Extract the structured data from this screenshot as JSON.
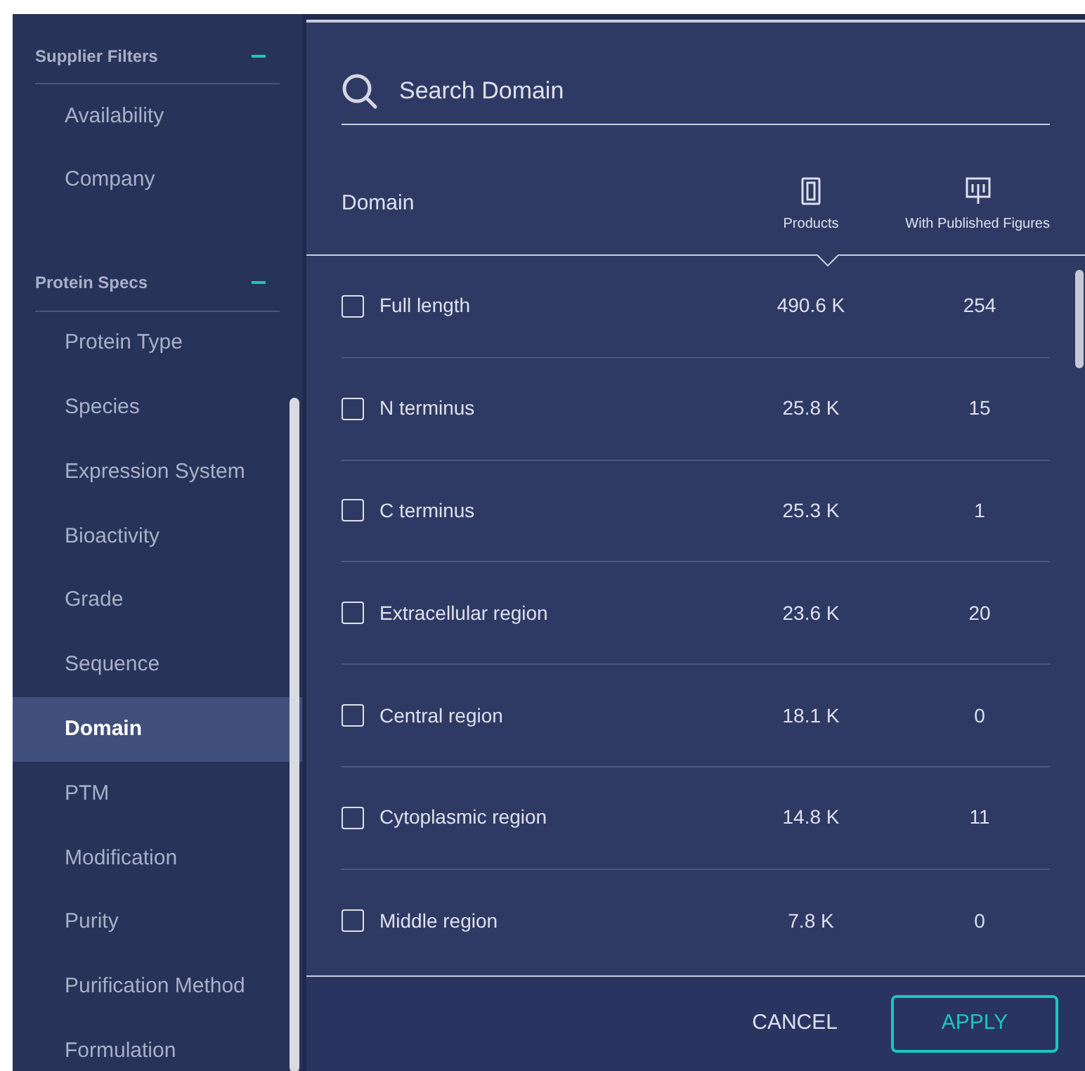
{
  "sidebar": {
    "groups": [
      {
        "title": "Supplier Filters",
        "expanded": true,
        "items": [
          {
            "label": "Availability",
            "selected": false
          },
          {
            "label": "Company",
            "selected": false
          }
        ]
      },
      {
        "title": "Protein Specs",
        "expanded": true,
        "items": [
          {
            "label": "Protein Type",
            "selected": false
          },
          {
            "label": "Species",
            "selected": false
          },
          {
            "label": "Expression System",
            "selected": false
          },
          {
            "label": "Bioactivity",
            "selected": false
          },
          {
            "label": "Grade",
            "selected": false
          },
          {
            "label": "Sequence",
            "selected": false
          },
          {
            "label": "Domain",
            "selected": true
          },
          {
            "label": "PTM",
            "selected": false
          },
          {
            "label": "Modification",
            "selected": false
          },
          {
            "label": "Purity",
            "selected": false
          },
          {
            "label": "Purification Method",
            "selected": false
          },
          {
            "label": "Formulation",
            "selected": false
          }
        ]
      }
    ]
  },
  "dialog": {
    "search": {
      "placeholder": "Search Domain"
    },
    "columns": {
      "name": "Domain",
      "products": "Products",
      "figures": "With Published Figures"
    },
    "rows": [
      {
        "label": "Full length",
        "products": "490.6 K",
        "figures": "254",
        "checked": false
      },
      {
        "label": "N terminus",
        "products": "25.8 K",
        "figures": "15",
        "checked": false
      },
      {
        "label": "C terminus",
        "products": "25.3 K",
        "figures": "1",
        "checked": false
      },
      {
        "label": "Extracellular region",
        "products": "23.6 K",
        "figures": "20",
        "checked": false
      },
      {
        "label": "Central region",
        "products": "18.1 K",
        "figures": "0",
        "checked": false
      },
      {
        "label": "Cytoplasmic region",
        "products": "14.8 K",
        "figures": "11",
        "checked": false
      },
      {
        "label": "Middle region",
        "products": "7.8 K",
        "figures": "0",
        "checked": false
      }
    ],
    "buttons": {
      "cancel": "CANCEL",
      "apply": "APPLY"
    }
  }
}
